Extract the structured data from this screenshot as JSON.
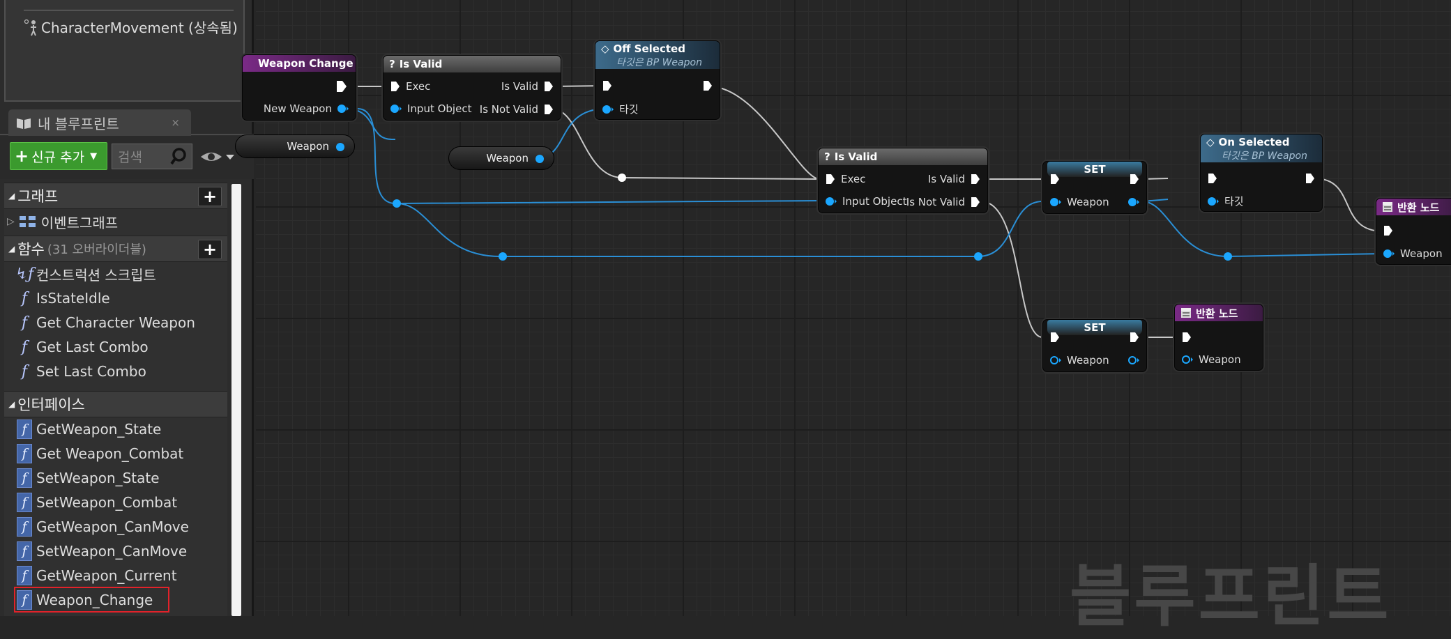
{
  "components": {
    "item": "CharacterMovement (상속됨)"
  },
  "my_blueprint": {
    "tab_label": "내 블루프린트",
    "close": "×",
    "add_new": "신규 추가",
    "search_placeholder": "검색",
    "sections": {
      "graph": "그래프",
      "event_graph": "이벤트그래프",
      "functions": "함수",
      "functions_override": "(31 오버라이더블)",
      "interfaces": "인터페이스"
    },
    "functions": [
      "컨스트럭션 스크립트",
      "IsStateIdle",
      "Get Character Weapon",
      "Get Last Combo",
      "Set Last Combo"
    ],
    "interfaces": [
      "GetWeapon_State",
      "Get Weapon_Combat",
      "SetWeapon_State",
      "SetWeapon_Combat",
      "GetWeapon_CanMove",
      "SetWeapon_CanMove",
      "GetWeapon_Current",
      "Weapon_Change"
    ],
    "selected": "Weapon_Change"
  },
  "graph": {
    "nodes": {
      "entry": {
        "title": "Weapon Change",
        "pin_new_weapon": "New Weapon"
      },
      "isvalid1": {
        "title": "Is Valid",
        "exec": "Exec",
        "input": "Input Object",
        "is_valid": "Is Valid",
        "not_valid": "Is Not Valid",
        "icon": "?"
      },
      "offsel": {
        "title": "Off Selected",
        "subtitle": "타깃은 BP Weapon",
        "target": "타깃"
      },
      "isvalid2": {
        "title": "Is Valid",
        "exec": "Exec",
        "input": "Input Object",
        "is_valid": "Is Valid",
        "not_valid": "Is Not Valid",
        "icon": "?"
      },
      "set1": {
        "title": "SET",
        "pin": "Weapon"
      },
      "onsel": {
        "title": "On Selected",
        "subtitle": "타깃은 BP Weapon",
        "target": "타깃"
      },
      "ret1": {
        "title": "반환 노드",
        "pin": "Weapon"
      },
      "set2": {
        "title": "SET",
        "pin": "Weapon"
      },
      "ret2": {
        "title": "반환 노드",
        "pin": "Weapon"
      }
    },
    "vars": {
      "weapon_a": "Weapon",
      "weapon_b": "Weapon"
    },
    "watermark": "블루프린트"
  },
  "colors": {
    "exec": "#ffffff",
    "object_pin": "#1ba7ff",
    "wire_object": "#2a8fd6",
    "wire_exec": "#c8c8c8",
    "add_button": "#3b9a2e",
    "selection": "#e2222a",
    "function_header": "#7a2a86"
  }
}
